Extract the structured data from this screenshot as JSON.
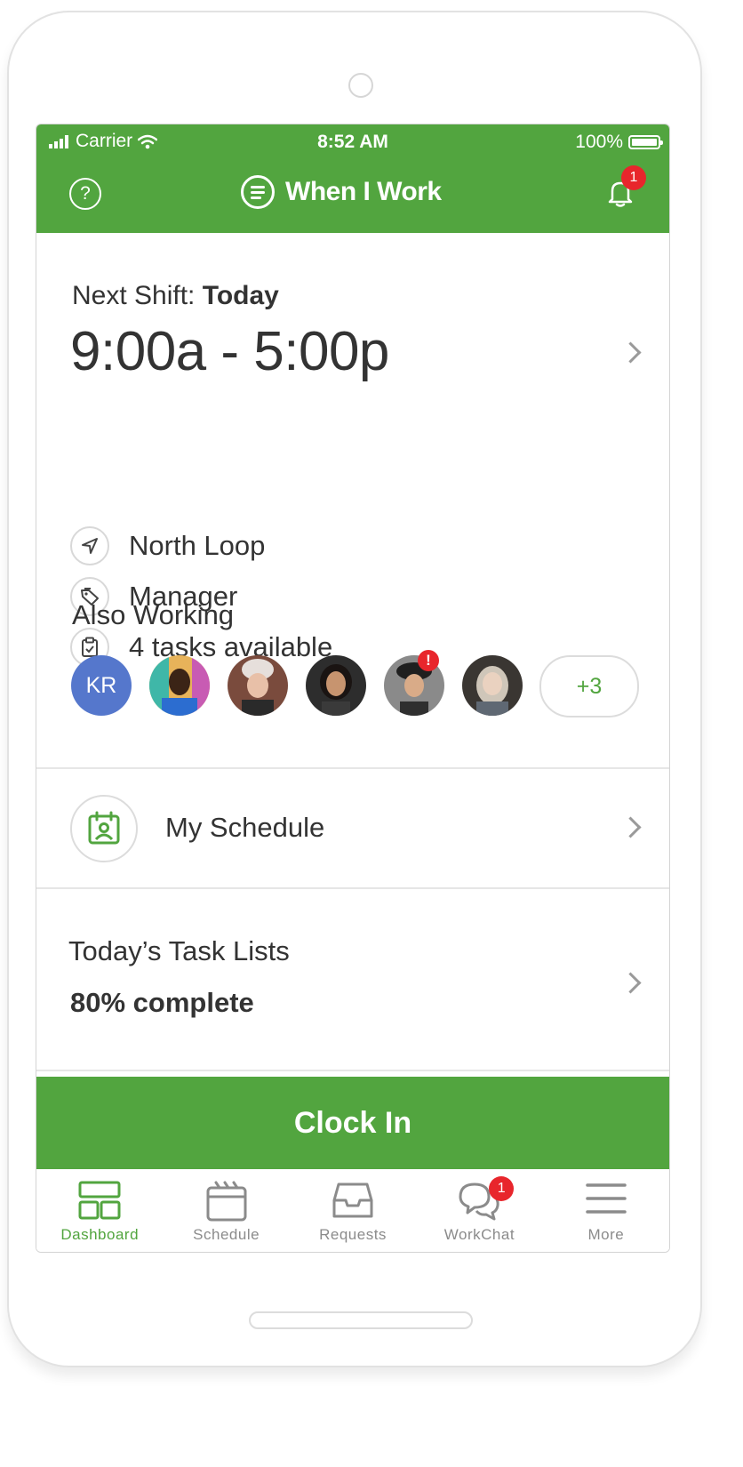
{
  "status_bar": {
    "carrier": "Carrier",
    "time": "8:52 AM",
    "battery": "100%"
  },
  "header": {
    "help_icon_text": "?",
    "logo_text": "When I Work",
    "notification_count": "1"
  },
  "next_shift": {
    "label": "Next Shift: ",
    "day": "Today",
    "time_range": "9:00a - 5:00p",
    "details": [
      {
        "icon": "location-arrow-icon",
        "text": "North Loop"
      },
      {
        "icon": "tag-icon",
        "text": "Manager"
      },
      {
        "icon": "clipboard-check-icon",
        "text": "4 tasks available"
      }
    ]
  },
  "also_working": {
    "label": "Also Working",
    "initials_avatar": "KR",
    "more_label": "+3"
  },
  "my_schedule": {
    "label": "My Schedule"
  },
  "task_lists": {
    "title": "Today’s Task Lists",
    "progress_text": "80% complete",
    "progress": 0.8
  },
  "clock_in": {
    "label": "Clock In"
  },
  "tabs": [
    {
      "label": "Dashboard",
      "icon": "dashboard-icon",
      "active": true
    },
    {
      "label": "Schedule",
      "icon": "schedule-icon",
      "active": false
    },
    {
      "label": "Requests",
      "icon": "inbox-icon",
      "active": false
    },
    {
      "label": "WorkChat",
      "icon": "chat-icon",
      "active": false,
      "badge": "1"
    },
    {
      "label": "More",
      "icon": "menu-icon",
      "active": false
    }
  ],
  "colors": {
    "brand_green": "#52a53f",
    "badge_red": "#e8262c",
    "avatar_blue": "#5577cc"
  }
}
